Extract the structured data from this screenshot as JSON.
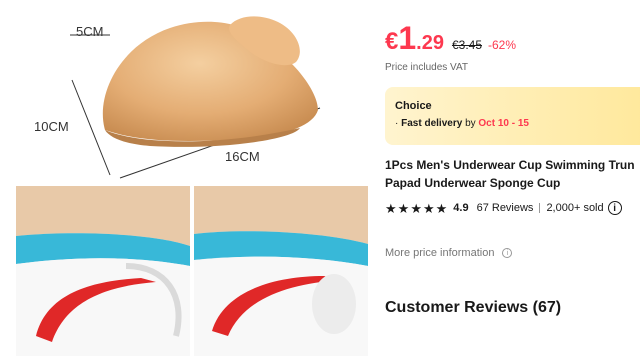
{
  "gallery": {
    "dimensions": {
      "height": "5CM",
      "depth": "10CM",
      "length": "16CM"
    }
  },
  "product": {
    "price": {
      "currency": "€",
      "integer": "1",
      "decimal": ".29",
      "original": "€3.45",
      "discount": "-62%"
    },
    "vat_note": "Price includes VAT",
    "choice": {
      "badge": "Choice",
      "bullet": "·",
      "delivery_label": "Fast delivery",
      "by": "by",
      "dates": "Oct 10 - 15"
    },
    "title_lines": [
      "1Pcs Men's Underwear Cup Swimming Trun",
      "Papad Underwear Sponge Cup"
    ],
    "rating": {
      "stars": [
        "★",
        "★",
        "★",
        "★",
        "★"
      ],
      "score": "4.9",
      "reviews": "67 Reviews",
      "sold": "2,000+ sold",
      "info_glyph": "i"
    },
    "more_price": "More price information",
    "more_price_glyph": "i",
    "customer_reviews": "Customer Reviews (67)"
  },
  "colors": {
    "price_red": "#fd384f",
    "choice_bg": "#ffe89a",
    "sponge": "#e8b47c"
  }
}
